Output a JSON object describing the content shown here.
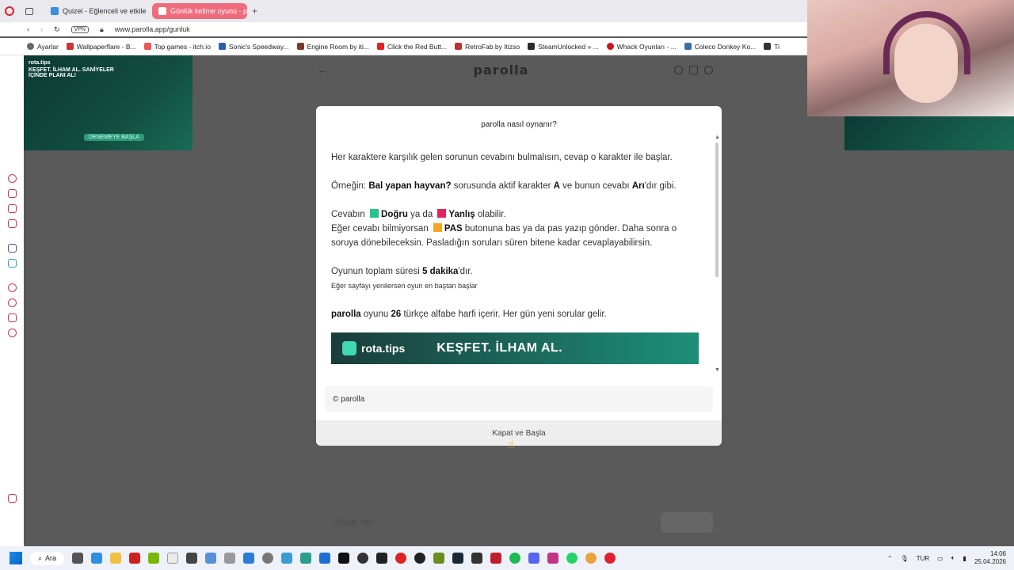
{
  "browser": {
    "tabs": [
      {
        "label": "Quizei - Eğlenceli ve etkile",
        "active": false
      },
      {
        "label": "Günlük kelime oyunu - par",
        "active": true
      }
    ],
    "new_tab": "+",
    "vpn_label": "VPN",
    "url": "www.parolla.app/gunluk",
    "bookmarks": [
      "Ayarlar",
      "Wallpaperflare - B...",
      "Top games - itch.io",
      "Sonic's Speedway...",
      "Engine Room by iti...",
      "Click the Red Butt...",
      "RetroFab by Itizso",
      "SteamUnlocked » ...",
      "Whack Oyunları - ...",
      "Coleco Donkey Ko...",
      "Ti"
    ]
  },
  "ad_left": {
    "brand": "rota.tips",
    "headline": "KEŞFET. İLHAM AL. SANİYELER İÇİNDE PLANI AL!",
    "cta": "DENEMEYE BAŞLA"
  },
  "app": {
    "title": "parolla",
    "answer_placeholder": "Cevabı Yaz"
  },
  "modal": {
    "title": "parolla nasıl oynanır?",
    "intro": "Her karaktere karşılık gelen sorunun cevabını bulmalısın, cevap o karakter ile başlar.",
    "example_prefix": "Örneğin: ",
    "example_question": "Bal yapan hayvan?",
    "example_mid": " sorusunda aktif karakter ",
    "example_char": "A",
    "example_mid2": " ve bunun cevabı ",
    "example_answer": "Arı",
    "example_suffix": "'dır gibi.",
    "answer_prefix": "Cevabın ",
    "correct": "Doğru",
    "or": " ya da ",
    "wrong": "Yanlış",
    "answer_suffix": " olabilir.",
    "pass_prefix": "Eğer cevabı bilmiyorsan ",
    "pass": "PAS",
    "pass_suffix": " butonuna bas ya da pas yazıp gönder. Daha sonra o soruya dönebileceksin. Pasladığın soruları süren bitene kadar cevaplayabilirsin.",
    "time_prefix": "Oyunun toplam süresi ",
    "time_value": "5 dakika",
    "time_suffix": "'dır.",
    "refresh_note": "Eğer sayfayı yenilersen oyun en baştan başlar",
    "letters_brand": "parolla",
    "letters_mid": " oyunu ",
    "letters_count": "26",
    "letters_suffix": " türkçe alfabe harfi içerir. Her gün yeni sorular gelir.",
    "promo_brand": "rota.tips",
    "promo_tag": "KEŞFET. İLHAM AL.",
    "footer": "© parolla",
    "close_button": "Kapat ve Başla"
  },
  "taskbar": {
    "search": "Ara",
    "lang": "TUR",
    "time": "14:06",
    "date": "25.04.2026"
  },
  "colors": {
    "correct": "#27c48a",
    "wrong": "#e0245e",
    "pass": "#f5a623",
    "active_tab": "#f06b7b"
  }
}
